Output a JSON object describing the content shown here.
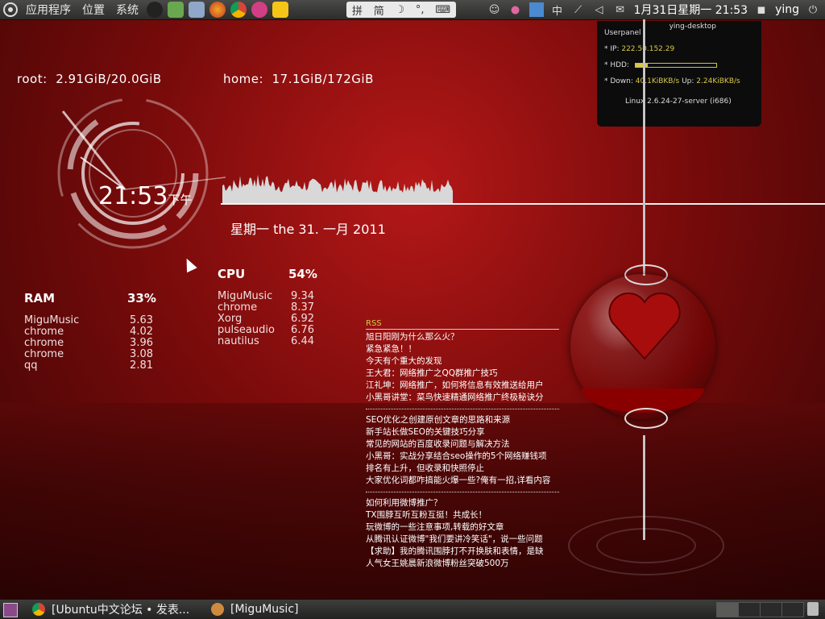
{
  "top_panel": {
    "menus": [
      "应用程序",
      "位置",
      "系统"
    ],
    "ime": [
      "拼",
      "简",
      "☽",
      "°,",
      "⌨"
    ],
    "ime_label": "中",
    "datetime": "1月31日星期一 21:53",
    "user": "ying"
  },
  "conky": {
    "root_label": "root:",
    "root_value": "2.91GiB/20.0GiB",
    "home_label": "home:",
    "home_value": "17.1GiB/172GiB",
    "time": "21:53",
    "ampm": "下午",
    "date": "星期一 the 31. 一月 2011",
    "ram": {
      "label": "RAM",
      "percent": "33%",
      "processes": [
        {
          "name": "MiguMusic",
          "value": "5.63"
        },
        {
          "name": "chrome",
          "value": "4.02"
        },
        {
          "name": "chrome",
          "value": "3.96"
        },
        {
          "name": "chrome",
          "value": "3.08"
        },
        {
          "name": "qq",
          "value": "2.81"
        }
      ]
    },
    "cpu": {
      "label": "CPU",
      "percent": "54%",
      "processes": [
        {
          "name": "MiguMusic",
          "value": "9.34"
        },
        {
          "name": "chrome",
          "value": "8.37"
        },
        {
          "name": "Xorg",
          "value": "6.92"
        },
        {
          "name": "pulseaudio",
          "value": "6.76"
        },
        {
          "name": "nautilus",
          "value": "6.44"
        }
      ]
    }
  },
  "userpanel": {
    "host": "ying-desktop",
    "title": "Userpanel",
    "ip_label": "* IP:",
    "ip": "222.50.152.29",
    "hdd_label": "* HDD:",
    "hdd_fraction": 0.15,
    "down_label": "* Down:",
    "down": "40.1KiBKB/s",
    "up_label": "Up:",
    "up": "2.24KiBKB/s",
    "kernel": "Linux 2.6.24-27-server (i686)"
  },
  "rss": {
    "title": "RSS",
    "groups": [
      [
        "旭日阳刚为什么那么火？",
        "紧急紧急！！",
        "今天有个重大的发现",
        "王大君：网络推广之QQ群推广技巧",
        "江礼坤：网络推广，如何将信息有效推送给用户",
        "小黑哥讲堂：菜鸟快速精通网络推广终极秘诀分"
      ],
      [
        "SEO优化之创建原创文章的思路和来源",
        "新手站长做SEO的关键技巧分享",
        "常见的网站的百度收录问题与解决方法",
        "小黑哥：实战分享结合seo操作的5个网络赚钱项",
        "排名有上升，但收录和快照停止",
        "大家优化词都咋搞能火爆一些?俺有一招,详看内容"
      ],
      [
        "如何利用微博推广？",
        "TX围脖互听互粉互挺！共成长！",
        "玩微博的一些注意事项,转载的好文章",
        "从腾讯认证微博\"我们要讲冷笑话\"，说一些问题",
        "【求助】我的腾讯围脖打不开换肤和表情，是缺",
        "人气女王姚晨新浪微博粉丝突破500万"
      ]
    ]
  },
  "bottom_panel": {
    "tasks": [
      "[Ubuntu中文论坛 • 发表...",
      "[MiguMusic]"
    ]
  }
}
